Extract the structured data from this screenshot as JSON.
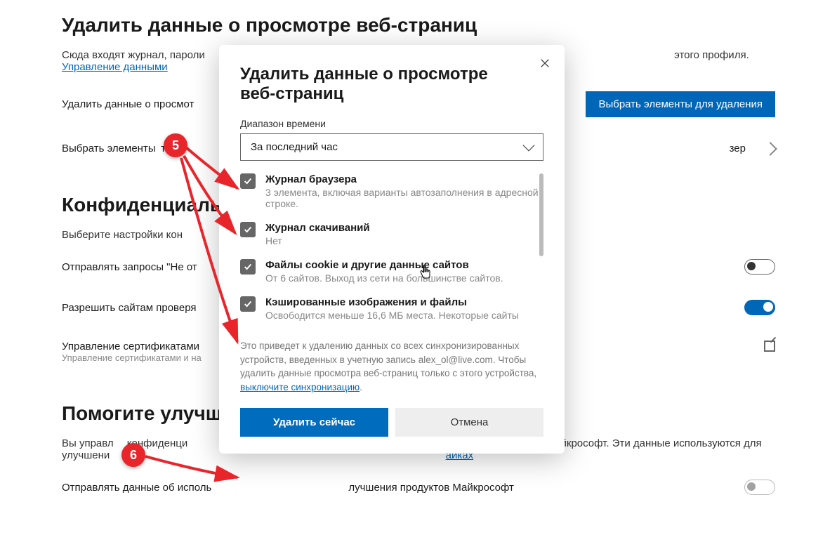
{
  "bg": {
    "h1": "Удалить данные о просмотре веб-страниц",
    "desc_prefix": "Сюда входят журнал, пароли",
    "desc_suffix": " этого профиля. ",
    "desc_link": "Управление данными",
    "row_delete_label": "Удалить данные о просмот",
    "row_delete_btn": "Выбрать элементы для удаления",
    "row_select_label": "Выбрать элементы",
    "row_select_suffix": "торы",
    "row_select_right": "зер",
    "h2_privacy": "Конфиденциально",
    "privacy_desc": "Выберите настройки кон",
    "privacy_link": "айках",
    "dnt_label": "Отправлять запросы \"Не от",
    "allow_label": "Разрешить сайтам проверя",
    "certs_label": "Управление сертификатами",
    "certs_sub": "Управление сертификатами и на",
    "h2_improve": "Помогите улучшит",
    "improve_desc_1": "Вы управл",
    "improve_desc_2": " конфиденци",
    "improve_desc_3": "ся в Майкрософт. Эти данные используются для улучшени",
    "improve_link": "айках",
    "send_data_label": "Отправлять данные об исполь",
    "send_data_suffix": "лучшения продуктов Майкрософт"
  },
  "dialog": {
    "title": "Удалить данные о просмотре веб-страниц",
    "time_label": "Диапазон времени",
    "time_value": "За последний час",
    "options": [
      {
        "title": "Журнал браузера",
        "desc": "3 элемента, включая варианты автозаполнения в адресной строке."
      },
      {
        "title": "Журнал скачиваний",
        "desc": "Нет"
      },
      {
        "title": "Файлы cookie и другие данные сайтов",
        "desc": "От 6 сайтов. Выход из сети на большинстве сайтов."
      },
      {
        "title": "Кэшированные изображения и файлы",
        "desc": "Освободится меньше 16,6 МБ места. Некоторые сайты"
      }
    ],
    "sync_text": "Это приведет к удалению данных со всех синхронизированных устройств, введенных в учетную запись alex_ol@live.com. Чтобы удалить данные просмотра веб-страниц только с этого устройства, ",
    "sync_link": "выключите синхронизацию",
    "btn_primary": "Удалить сейчас",
    "btn_cancel": "Отмена"
  },
  "annotations": {
    "badge5": "5",
    "badge6": "6"
  }
}
